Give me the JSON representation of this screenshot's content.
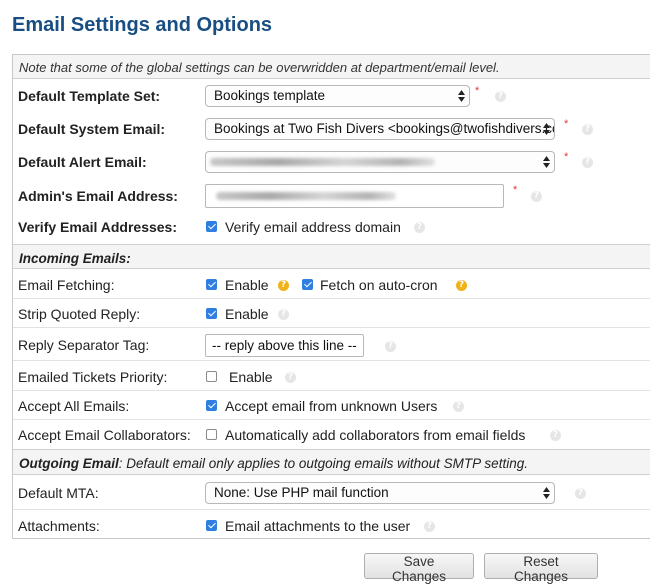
{
  "page": {
    "title": "Email Settings and Options"
  },
  "note": "Note that some of the global settings can be overwridden at department/email level.",
  "general": {
    "default_template_set": {
      "label": "Default Template Set:",
      "value": "Bookings template"
    },
    "default_system_email": {
      "label": "Default System Email:",
      "value": "Bookings at Two Fish Divers <bookings@twofishdivers.com>"
    },
    "default_alert_email": {
      "label": "Default Alert Email:",
      "value": ""
    },
    "admin_email": {
      "label": "Admin's Email Address:",
      "value": ""
    },
    "verify_email": {
      "label": "Verify Email Addresses:",
      "checkbox_label": "Verify email address domain",
      "checked": true
    }
  },
  "incoming": {
    "section_title": "Incoming Emails:",
    "fetching": {
      "label": "Email Fetching:",
      "enable_label": "Enable",
      "enable_checked": true,
      "autocron_label": "Fetch on auto-cron",
      "autocron_checked": true
    },
    "strip_quoted": {
      "label": "Strip Quoted Reply:",
      "checkbox_label": "Enable",
      "checked": true
    },
    "reply_separator": {
      "label": "Reply Separator Tag:",
      "value": "-- reply above this line --"
    },
    "tickets_priority": {
      "label": "Emailed Tickets Priority:",
      "checkbox_label": "Enable",
      "checked": false
    },
    "accept_all": {
      "label": "Accept All Emails:",
      "checkbox_label": "Accept email from unknown Users",
      "checked": true
    },
    "collaborators": {
      "label": "Accept Email Collaborators:",
      "checkbox_label": "Automatically add collaborators from email fields",
      "checked": false
    }
  },
  "outgoing": {
    "section_title": "Outgoing Email",
    "section_note": ": Default email only applies to outgoing emails without SMTP setting.",
    "default_mta": {
      "label": "Default MTA:",
      "value": "None: Use PHP mail function"
    },
    "attachments": {
      "label": "Attachments:",
      "checkbox_label": "Email attachments to the user",
      "checked": true
    }
  },
  "buttons": {
    "save": "Save Changes",
    "reset": "Reset Changes"
  },
  "symbols": {
    "required": "*",
    "help": "?"
  },
  "colors": {
    "title": "#184e81",
    "checkbox": "#2f7fe0",
    "required": "#e03c31",
    "help_highlight": "#f0b21a"
  }
}
